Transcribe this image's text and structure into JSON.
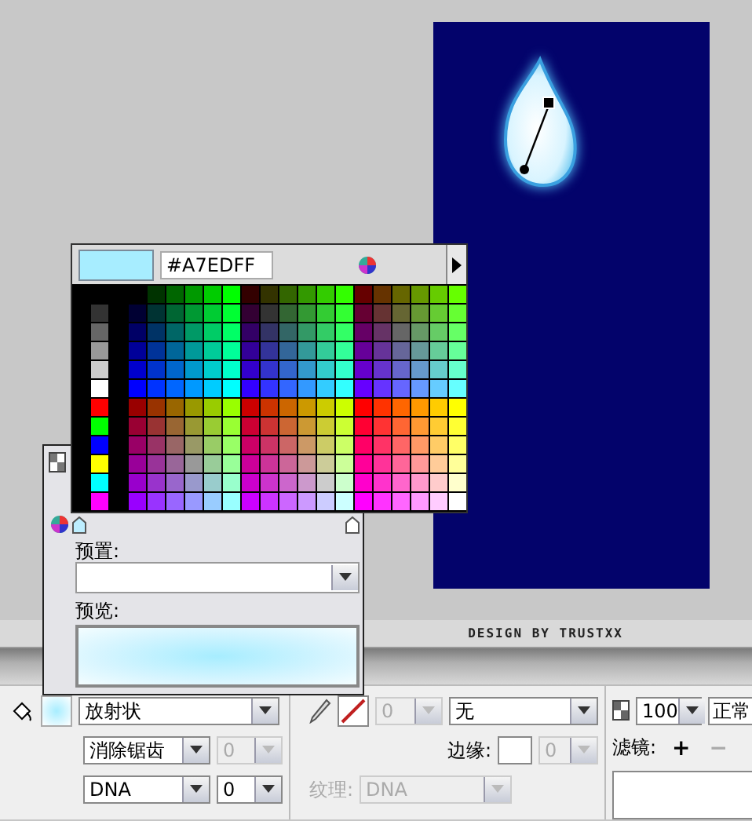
{
  "canvas": {
    "credit": "DESIGN BY TRUSTXX"
  },
  "color_popup": {
    "hex": "#A7EDFF"
  },
  "gradient_panel": {
    "preset_label": "预置:",
    "preview_label": "预览:"
  },
  "properties": {
    "fill_type": "放射状",
    "antialias": "消除锯齿",
    "antialias_amount": {
      "value": "0",
      "disabled": true
    },
    "texture_select": "DNA",
    "texture_amount": "0",
    "stroke_width": {
      "value": "0",
      "disabled": true
    },
    "stroke_style": "无",
    "edge_label": "边缘:",
    "edge_amount": {
      "value": "0",
      "disabled": true
    },
    "texture_label": "纹理:",
    "stroke_texture": {
      "value": "DNA",
      "disabled": true
    },
    "opacity": "100",
    "blend": "正常",
    "filters_label": "滤镜:",
    "add": "+",
    "remove": "−"
  }
}
